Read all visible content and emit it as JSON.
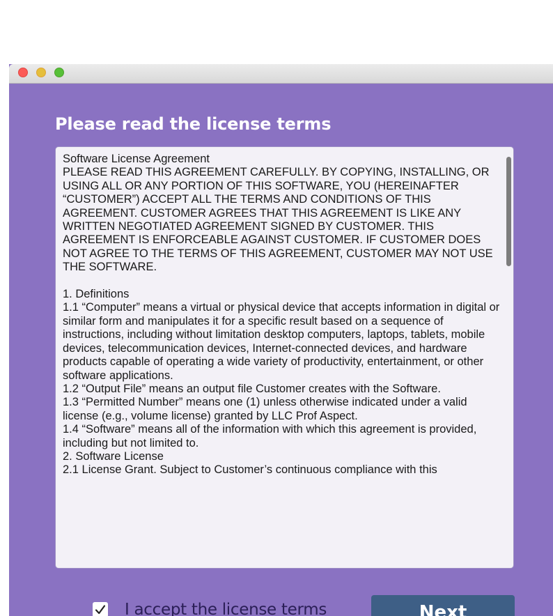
{
  "dialog": {
    "heading": "Please read the license terms",
    "license_text": "Software License Agreement\nPLEASE READ THIS AGREEMENT CAREFULLY. BY COPYING, INSTALLING, OR USING ALL OR ANY PORTION OF THIS SOFTWARE, YOU (HEREINAFTER “CUSTOMER”) ACCEPT ALL THE TERMS AND CONDITIONS OF THIS AGREEMENT. CUSTOMER AGREES THAT THIS AGREEMENT IS LIKE ANY WRITTEN NEGOTIATED AGREEMENT SIGNED BY CUSTOMER. THIS AGREEMENT IS ENFORCEABLE AGAINST CUSTOMER. IF CUSTOMER DOES NOT AGREE TO THE TERMS OF THIS AGREEMENT, CUSTOMER MAY NOT USE THE SOFTWARE.\n\n1. Definitions\n1.1 “Computer” means a virtual or physical device that accepts information in digital or similar form and manipulates it for a specific result based on a sequence of instructions, including without limitation desktop computers, laptops, tablets, mobile devices, telecommunication devices, Internet-connected devices, and hardware products capable of operating a wide variety of productivity, entertainment, or other software applications.\n1.2 “Output File” means an output file Customer creates with the Software.\n1.3 “Permitted Number” means one (1) unless otherwise indicated under a valid license (e.g., volume license) granted by LLC Prof Aspect.\n1.4 “Software” means all of the information with which this agreement is provided, including but not limited to.\n2. Software License\n2.1 License Grant. Subject to Customer’s continuous compliance with this",
    "accept_label": "I accept the license terms",
    "accept_checked": true,
    "next_label": "Next"
  },
  "colors": {
    "window_background": "#8a72c2",
    "next_button": "#3e5f86",
    "accept_label": "#2b1f57"
  }
}
